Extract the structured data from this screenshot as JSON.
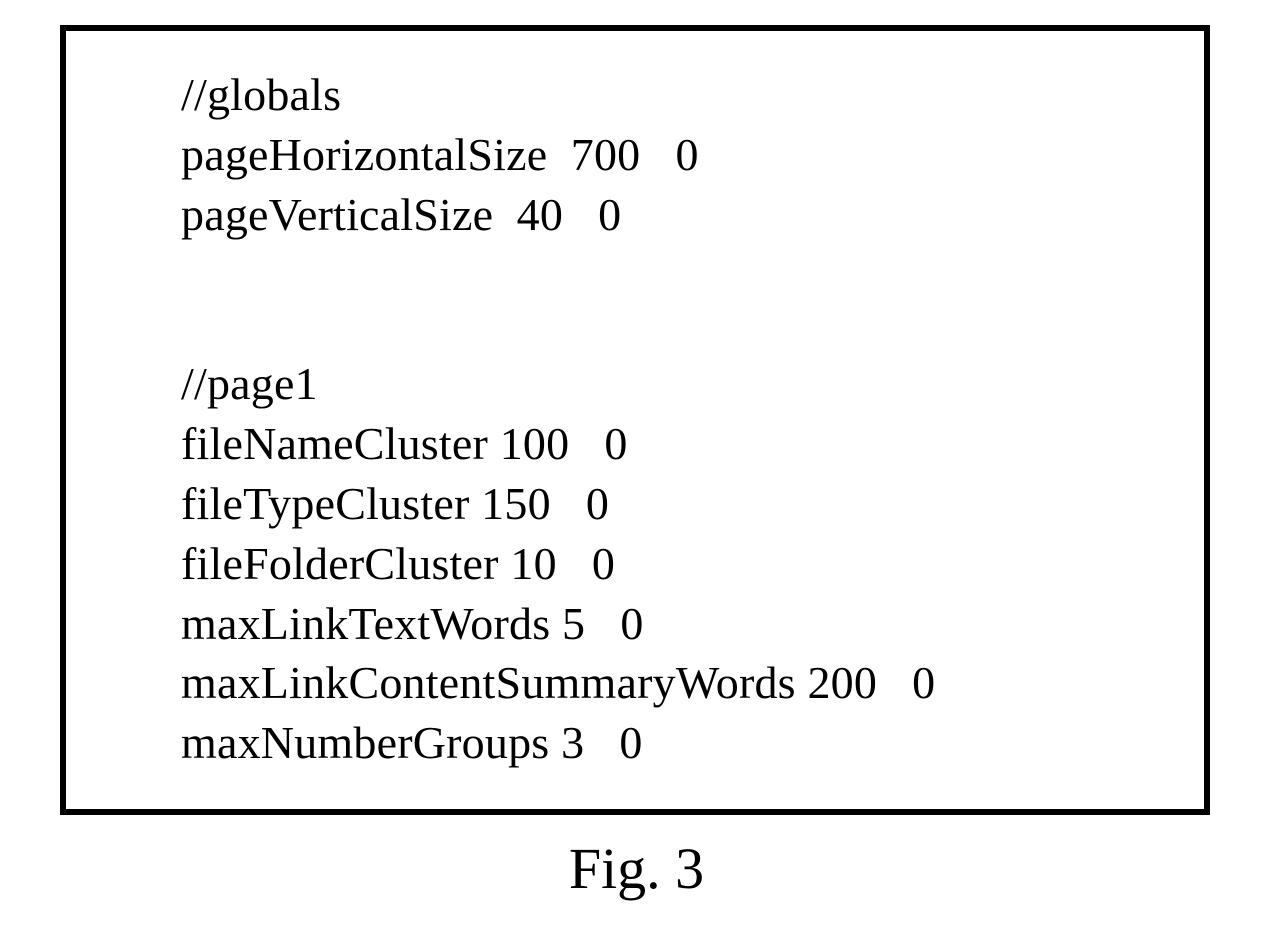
{
  "lines": {
    "l0": "//globals",
    "l1": "pageHorizontalSize  700   0",
    "l2": "pageVerticalSize  40   0",
    "l3": "//page1",
    "l4": "fileNameCluster 100   0",
    "l5": "fileTypeCluster 150   0",
    "l6": "fileFolderCluster 10   0",
    "l7": "maxLinkTextWords 5   0",
    "l8": "maxLinkContentSummaryWords 200   0",
    "l9": "maxNumberGroups 3   0"
  },
  "caption": "Fig. 3"
}
